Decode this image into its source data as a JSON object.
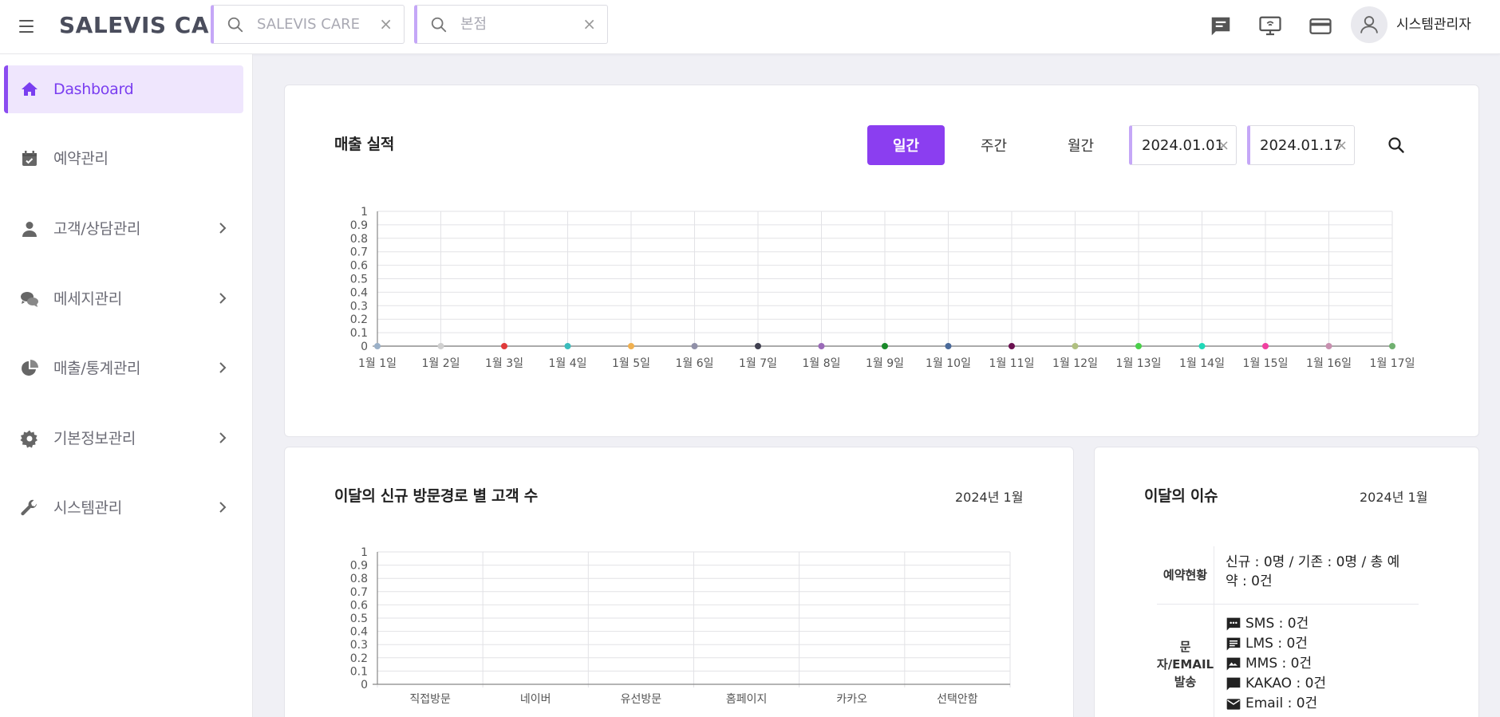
{
  "app": {
    "logo": "SALEVIS CARE",
    "search1": {
      "value": "SALEVIS CARE",
      "clear": "×"
    },
    "search2": {
      "placeholder": "본점",
      "clear": "×"
    },
    "header_icons": [
      "message-icon",
      "monitor-icon",
      "card-icon"
    ],
    "user": "시스템관리자"
  },
  "sidebar": {
    "items": [
      {
        "label": "Dashboard",
        "icon": "home-icon",
        "active": true
      },
      {
        "label": "예약관리",
        "icon": "calendar-icon"
      },
      {
        "label": "고객/상담관리",
        "icon": "person-icon",
        "expandable": true
      },
      {
        "label": "메세지관리",
        "icon": "chat-icon",
        "expandable": true
      },
      {
        "label": "매출/통계관리",
        "icon": "pie-icon",
        "expandable": true
      },
      {
        "label": "기본정보관리",
        "icon": "gear-icon",
        "expandable": true
      },
      {
        "label": "시스템관리",
        "icon": "wrench-icon",
        "expandable": true
      }
    ]
  },
  "sales": {
    "title": "매출 실적",
    "periods": [
      "일간",
      "주간",
      "월간"
    ],
    "active_period": "일간",
    "start_date": "2024.01.01",
    "end_date": "2024.01.17",
    "clear": "×"
  },
  "visit": {
    "title": "이달의 신규 방문경로 별 고객 수",
    "date": "2024년 1월"
  },
  "issues": {
    "title": "이달의 이슈",
    "date": "2024년 1월",
    "reservation_head": "예약현황",
    "reservation_value": "신규 : 0명 / 기존 : 0명 / 총 예약 : 0건",
    "message_head": "문자/EMAIL 발송",
    "messages": [
      {
        "label": "SMS : 0건",
        "icon": "sms-icon"
      },
      {
        "label": "LMS : 0건",
        "icon": "lms-icon"
      },
      {
        "label": "MMS : 0건",
        "icon": "mms-icon"
      },
      {
        "label": "KAKAO : 0건",
        "icon": "kakao-icon"
      },
      {
        "label": "Email : 0건",
        "icon": "email-icon"
      }
    ]
  },
  "chart_data": [
    {
      "type": "line",
      "x": [
        "1월 1일",
        "1월 2일",
        "1월 3일",
        "1월 4일",
        "1월 5일",
        "1월 6일",
        "1월 7일",
        "1월 8일",
        "1월 9일",
        "1월 10일",
        "1월 11일",
        "1월 12일",
        "1월 13일",
        "1월 14일",
        "1월 15일",
        "1월 16일",
        "1월 17일"
      ],
      "values": [
        0,
        0,
        0,
        0,
        0,
        0,
        0,
        0,
        0,
        0,
        0,
        0,
        0,
        0,
        0,
        0,
        0
      ],
      "point_colors": [
        "#9ab0c8",
        "#d0d0d0",
        "#e03a3a",
        "#3bbdbd",
        "#f0b050",
        "#9090a8",
        "#404050",
        "#9a6ab8",
        "#1a8a2a",
        "#4a6a9a",
        "#6a1050",
        "#b0c080",
        "#4ad04a",
        "#20d8b8",
        "#f040a0",
        "#c890b0",
        "#70b070"
      ],
      "yticks": [
        "0",
        "0.1",
        "0.2",
        "0.3",
        "0.4",
        "0.5",
        "0.6",
        "0.7",
        "0.8",
        "0.9",
        "1"
      ],
      "ylim": [
        0,
        1
      ],
      "grid": true
    },
    {
      "type": "bar",
      "categories": [
        "직접방문",
        "네이버",
        "유선방문",
        "홈페이지",
        "카카오",
        "선택안함"
      ],
      "values": [
        0,
        0,
        0,
        0,
        0,
        0
      ],
      "yticks": [
        "0",
        "0.1",
        "0.2",
        "0.3",
        "0.4",
        "0.5",
        "0.6",
        "0.7",
        "0.8",
        "0.9",
        "1"
      ],
      "ylim": [
        0,
        1
      ],
      "grid": true
    }
  ]
}
